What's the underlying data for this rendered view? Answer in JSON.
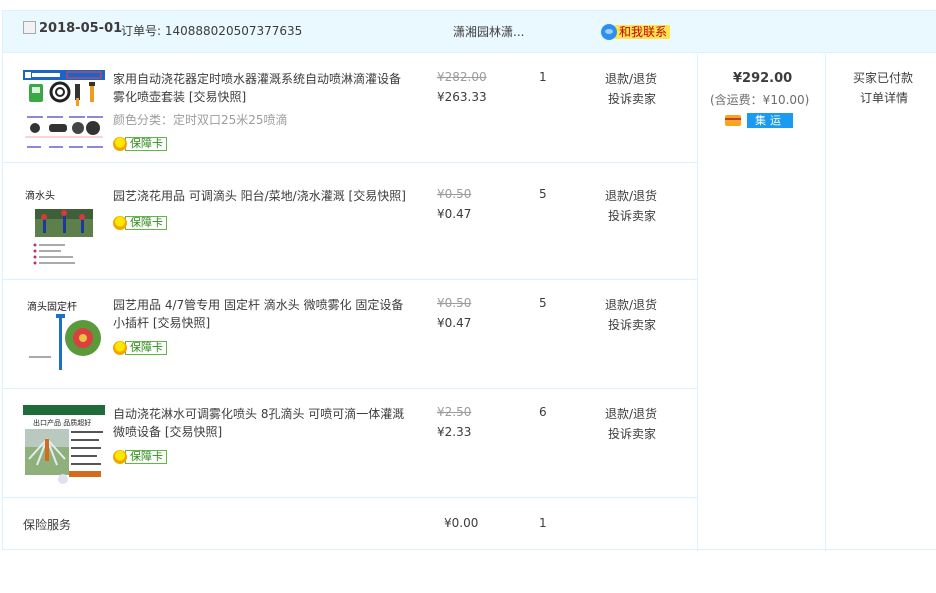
{
  "order": {
    "date": "2018-05-01",
    "order_no_label": "订单号: ",
    "order_no": "140888020507377635",
    "shop_name": "潇湘园林潇...",
    "contact_label": "和我联系",
    "total": "¥292.00",
    "shipping": "(含运费：¥10.00)",
    "collect_label": "集运",
    "status": "买家已付款",
    "detail_link": "订单详情"
  },
  "items": [
    {
      "title": "家用自动浇花器定时喷水器灌溉系统自动喷淋滴灌设备雾化喷壶套装 [交易快照]",
      "sku": "颜色分类：定时双口25米25喷滴",
      "guarantee": "保障卡",
      "price_orig": "¥282.00",
      "price_now": "¥263.33",
      "qty": "1",
      "action1": "退款/退货",
      "action2": "投诉卖家"
    },
    {
      "title": "园艺浇花用品 可调滴头 阳台/菜地/浇水灌溉 [交易快照]",
      "thumb_label": "滴水头",
      "guarantee": "保障卡",
      "price_orig": "¥0.50",
      "price_now": "¥0.47",
      "qty": "5",
      "action1": "退款/退货",
      "action2": "投诉卖家"
    },
    {
      "title": "园艺用品 4/7管专用 固定杆 滴水头 微喷雾化 固定设备小插杆 [交易快照]",
      "thumb_label": "滴头固定杆",
      "guarantee": "保障卡",
      "price_orig": "¥0.50",
      "price_now": "¥0.47",
      "qty": "5",
      "action1": "退款/退货",
      "action2": "投诉卖家"
    },
    {
      "title": "自动浇花淋水可调雾化喷头 8孔滴头 可喷可滴一体灌溉微喷设备 [交易快照]",
      "thumb_label": "出口产品 品质超好",
      "guarantee": "保障卡",
      "price_orig": "¥2.50",
      "price_now": "¥2.33",
      "qty": "6",
      "action1": "退款/退货",
      "action2": "投诉卖家"
    }
  ],
  "insurance": {
    "label": "保险服务",
    "price": "¥0.00",
    "qty": "1"
  },
  "colors": {
    "header_bg": "#eaf8ff",
    "border": "#daf3ff",
    "guarantee_green": "#5fb845",
    "collect_blue": "#1a9bf1",
    "contact_yellow": "#ffe44d",
    "contact_red": "#c40000"
  },
  "icons": {
    "checkbox": "checkbox-icon",
    "wangwang": "wangwang-chat-icon",
    "guarantee": "guarantee-badge-icon",
    "card": "credit-card-icon"
  }
}
